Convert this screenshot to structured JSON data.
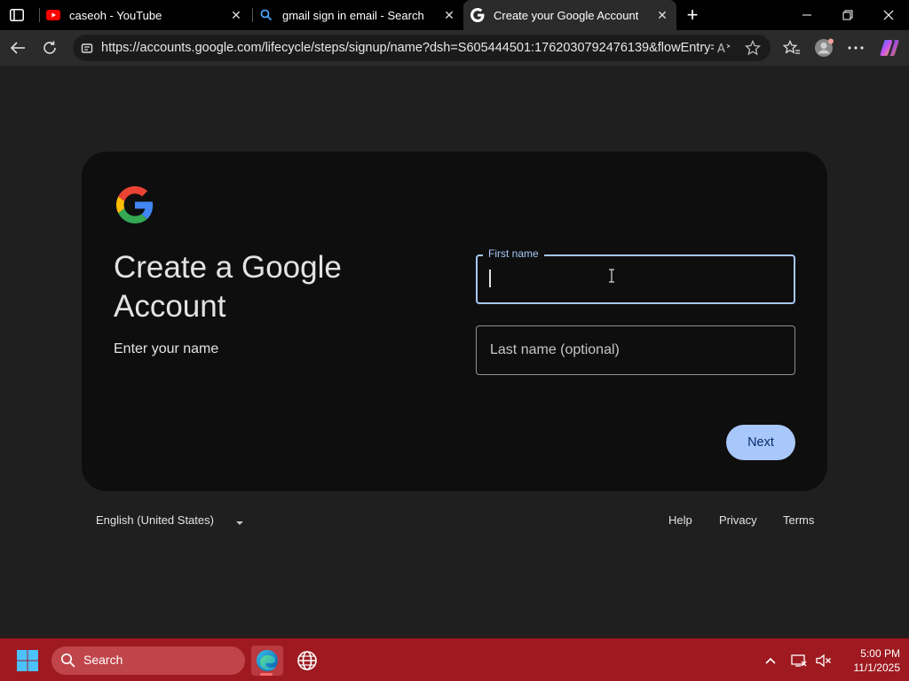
{
  "browser": {
    "tabs": [
      {
        "title": "caseoh - YouTube",
        "icon": "youtube-icon"
      },
      {
        "title": "gmail sign in email - Search",
        "icon": "search-icon"
      },
      {
        "title": "Create your Google Account",
        "icon": "google-icon",
        "active": true
      }
    ],
    "address": "https://accounts.google.com/lifecycle/steps/signup/name?dsh=S605444501:1762030792476139&flowEntry=..."
  },
  "page": {
    "heading": "Create a Google Account",
    "subheading": "Enter your name",
    "first_name_label": "First name",
    "first_name_value": "",
    "last_name_placeholder": "Last name (optional)",
    "next_label": "Next",
    "language": "English (United States)",
    "footer_links": [
      "Help",
      "Privacy",
      "Terms"
    ]
  },
  "taskbar": {
    "search_label": "Search",
    "time": "5:00 PM",
    "date": "11/1/2025"
  },
  "colors": {
    "accent": "#a8c7fa",
    "taskbar": "#9e1a20",
    "card": "#0e0e0e"
  }
}
